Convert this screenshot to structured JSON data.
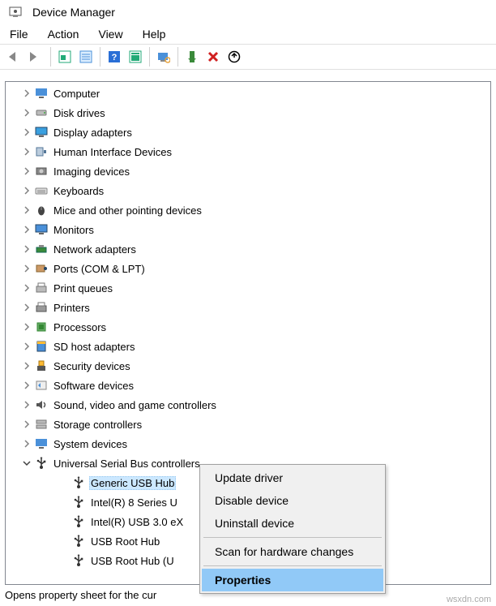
{
  "window": {
    "title": "Device Manager"
  },
  "menu": {
    "file": "File",
    "action": "Action",
    "view": "View",
    "help": "Help"
  },
  "tree": {
    "items": [
      {
        "label": "Computer",
        "i": "computer"
      },
      {
        "label": "Disk drives",
        "i": "disk"
      },
      {
        "label": "Display adapters",
        "i": "display"
      },
      {
        "label": "Human Interface Devices",
        "i": "hid"
      },
      {
        "label": "Imaging devices",
        "i": "camera"
      },
      {
        "label": "Keyboards",
        "i": "keyboard"
      },
      {
        "label": "Mice and other pointing devices",
        "i": "mouse"
      },
      {
        "label": "Monitors",
        "i": "monitor"
      },
      {
        "label": "Network adapters",
        "i": "network"
      },
      {
        "label": "Ports (COM & LPT)",
        "i": "port"
      },
      {
        "label": "Print queues",
        "i": "printqueue"
      },
      {
        "label": "Printers",
        "i": "printer"
      },
      {
        "label": "Processors",
        "i": "cpu"
      },
      {
        "label": "SD host adapters",
        "i": "sd"
      },
      {
        "label": "Security devices",
        "i": "security"
      },
      {
        "label": "Software devices",
        "i": "software"
      },
      {
        "label": "Sound, video and game controllers",
        "i": "sound"
      },
      {
        "label": "Storage controllers",
        "i": "storage"
      },
      {
        "label": "System devices",
        "i": "system"
      },
      {
        "label": "Universal Serial Bus controllers",
        "i": "usb",
        "expanded": true
      }
    ],
    "usb_children": [
      {
        "label": "Generic USB Hub",
        "selected": true
      },
      {
        "label": "Intel(R) 8 Series U"
      },
      {
        "label": "Intel(R) USB 3.0 eX"
      },
      {
        "label": "USB Root Hub"
      },
      {
        "label": "USB Root Hub (U"
      }
    ]
  },
  "context_menu": {
    "items": [
      {
        "label": "Update driver"
      },
      {
        "label": "Disable device"
      },
      {
        "label": "Uninstall device"
      },
      {
        "sep": true
      },
      {
        "label": "Scan for hardware changes"
      },
      {
        "sep": true
      },
      {
        "label": "Properties",
        "highlight": true
      }
    ]
  },
  "status": "Opens property sheet for the cur",
  "watermark": "wsxdn.com"
}
